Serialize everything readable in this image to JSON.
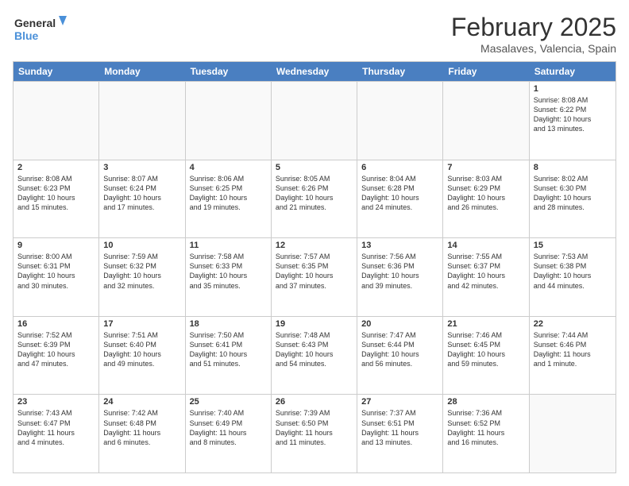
{
  "header": {
    "logo_general": "General",
    "logo_blue": "Blue",
    "month_title": "February 2025",
    "location": "Masalaves, Valencia, Spain"
  },
  "weekdays": [
    "Sunday",
    "Monday",
    "Tuesday",
    "Wednesday",
    "Thursday",
    "Friday",
    "Saturday"
  ],
  "rows": [
    [
      {
        "day": "",
        "text": ""
      },
      {
        "day": "",
        "text": ""
      },
      {
        "day": "",
        "text": ""
      },
      {
        "day": "",
        "text": ""
      },
      {
        "day": "",
        "text": ""
      },
      {
        "day": "",
        "text": ""
      },
      {
        "day": "1",
        "text": "Sunrise: 8:08 AM\nSunset: 6:22 PM\nDaylight: 10 hours\nand 13 minutes."
      }
    ],
    [
      {
        "day": "2",
        "text": "Sunrise: 8:08 AM\nSunset: 6:23 PM\nDaylight: 10 hours\nand 15 minutes."
      },
      {
        "day": "3",
        "text": "Sunrise: 8:07 AM\nSunset: 6:24 PM\nDaylight: 10 hours\nand 17 minutes."
      },
      {
        "day": "4",
        "text": "Sunrise: 8:06 AM\nSunset: 6:25 PM\nDaylight: 10 hours\nand 19 minutes."
      },
      {
        "day": "5",
        "text": "Sunrise: 8:05 AM\nSunset: 6:26 PM\nDaylight: 10 hours\nand 21 minutes."
      },
      {
        "day": "6",
        "text": "Sunrise: 8:04 AM\nSunset: 6:28 PM\nDaylight: 10 hours\nand 24 minutes."
      },
      {
        "day": "7",
        "text": "Sunrise: 8:03 AM\nSunset: 6:29 PM\nDaylight: 10 hours\nand 26 minutes."
      },
      {
        "day": "8",
        "text": "Sunrise: 8:02 AM\nSunset: 6:30 PM\nDaylight: 10 hours\nand 28 minutes."
      }
    ],
    [
      {
        "day": "9",
        "text": "Sunrise: 8:00 AM\nSunset: 6:31 PM\nDaylight: 10 hours\nand 30 minutes."
      },
      {
        "day": "10",
        "text": "Sunrise: 7:59 AM\nSunset: 6:32 PM\nDaylight: 10 hours\nand 32 minutes."
      },
      {
        "day": "11",
        "text": "Sunrise: 7:58 AM\nSunset: 6:33 PM\nDaylight: 10 hours\nand 35 minutes."
      },
      {
        "day": "12",
        "text": "Sunrise: 7:57 AM\nSunset: 6:35 PM\nDaylight: 10 hours\nand 37 minutes."
      },
      {
        "day": "13",
        "text": "Sunrise: 7:56 AM\nSunset: 6:36 PM\nDaylight: 10 hours\nand 39 minutes."
      },
      {
        "day": "14",
        "text": "Sunrise: 7:55 AM\nSunset: 6:37 PM\nDaylight: 10 hours\nand 42 minutes."
      },
      {
        "day": "15",
        "text": "Sunrise: 7:53 AM\nSunset: 6:38 PM\nDaylight: 10 hours\nand 44 minutes."
      }
    ],
    [
      {
        "day": "16",
        "text": "Sunrise: 7:52 AM\nSunset: 6:39 PM\nDaylight: 10 hours\nand 47 minutes."
      },
      {
        "day": "17",
        "text": "Sunrise: 7:51 AM\nSunset: 6:40 PM\nDaylight: 10 hours\nand 49 minutes."
      },
      {
        "day": "18",
        "text": "Sunrise: 7:50 AM\nSunset: 6:41 PM\nDaylight: 10 hours\nand 51 minutes."
      },
      {
        "day": "19",
        "text": "Sunrise: 7:48 AM\nSunset: 6:43 PM\nDaylight: 10 hours\nand 54 minutes."
      },
      {
        "day": "20",
        "text": "Sunrise: 7:47 AM\nSunset: 6:44 PM\nDaylight: 10 hours\nand 56 minutes."
      },
      {
        "day": "21",
        "text": "Sunrise: 7:46 AM\nSunset: 6:45 PM\nDaylight: 10 hours\nand 59 minutes."
      },
      {
        "day": "22",
        "text": "Sunrise: 7:44 AM\nSunset: 6:46 PM\nDaylight: 11 hours\nand 1 minute."
      }
    ],
    [
      {
        "day": "23",
        "text": "Sunrise: 7:43 AM\nSunset: 6:47 PM\nDaylight: 11 hours\nand 4 minutes."
      },
      {
        "day": "24",
        "text": "Sunrise: 7:42 AM\nSunset: 6:48 PM\nDaylight: 11 hours\nand 6 minutes."
      },
      {
        "day": "25",
        "text": "Sunrise: 7:40 AM\nSunset: 6:49 PM\nDaylight: 11 hours\nand 8 minutes."
      },
      {
        "day": "26",
        "text": "Sunrise: 7:39 AM\nSunset: 6:50 PM\nDaylight: 11 hours\nand 11 minutes."
      },
      {
        "day": "27",
        "text": "Sunrise: 7:37 AM\nSunset: 6:51 PM\nDaylight: 11 hours\nand 13 minutes."
      },
      {
        "day": "28",
        "text": "Sunrise: 7:36 AM\nSunset: 6:52 PM\nDaylight: 11 hours\nand 16 minutes."
      },
      {
        "day": "",
        "text": ""
      }
    ]
  ]
}
